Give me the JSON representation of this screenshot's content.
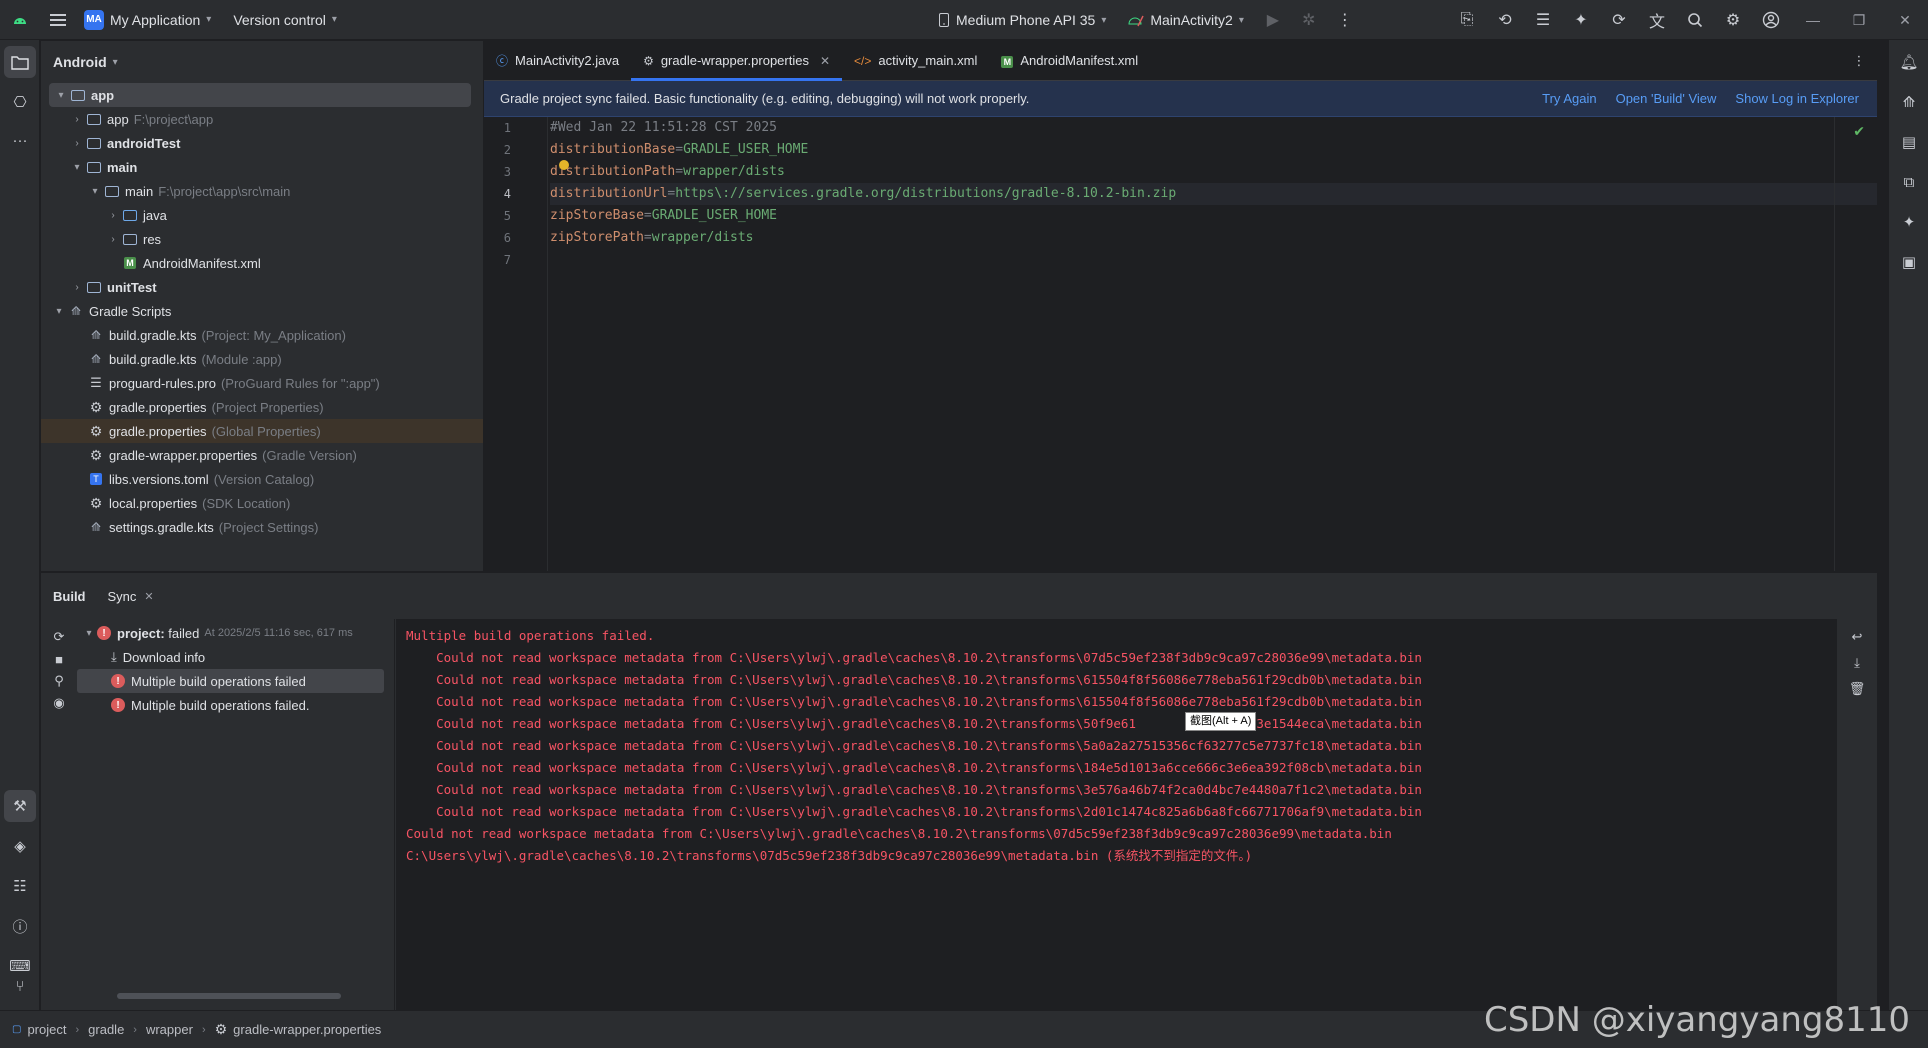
{
  "titlebar": {
    "project_badge": "MA",
    "project_name": "My Application",
    "version_control": "Version control",
    "device": "Medium Phone API 35",
    "run_config": "MainActivity2"
  },
  "project_panel": {
    "view_mode": "Android",
    "tree": [
      {
        "label": "app",
        "hint": "",
        "indent": 0
      },
      {
        "label": "app",
        "hint": "F:\\project\\app",
        "indent": 1
      },
      {
        "label": "androidTest",
        "hint": "",
        "indent": 1
      },
      {
        "label": "main",
        "hint": "",
        "indent": 1
      },
      {
        "label": "main",
        "hint": "F:\\project\\app\\src\\main",
        "indent": 2
      },
      {
        "label": "java",
        "hint": "",
        "indent": 3
      },
      {
        "label": "res",
        "hint": "",
        "indent": 3
      },
      {
        "label": "AndroidManifest.xml",
        "hint": "",
        "indent": 3
      },
      {
        "label": "unitTest",
        "hint": "",
        "indent": 1
      },
      {
        "label": "Gradle Scripts",
        "hint": "",
        "indent": 0
      },
      {
        "label": "build.gradle.kts",
        "hint": "(Project: My_Application)",
        "indent": 1
      },
      {
        "label": "build.gradle.kts",
        "hint": "(Module :app)",
        "indent": 1
      },
      {
        "label": "proguard-rules.pro",
        "hint": "(ProGuard Rules for \":app\")",
        "indent": 1
      },
      {
        "label": "gradle.properties",
        "hint": "(Project Properties)",
        "indent": 1
      },
      {
        "label": "gradle.properties",
        "hint": "(Global Properties)",
        "indent": 1
      },
      {
        "label": "gradle-wrapper.properties",
        "hint": "(Gradle Version)",
        "indent": 1
      },
      {
        "label": "libs.versions.toml",
        "hint": "(Version Catalog)",
        "indent": 1
      },
      {
        "label": "local.properties",
        "hint": "(SDK Location)",
        "indent": 1
      },
      {
        "label": "settings.gradle.kts",
        "hint": "(Project Settings)",
        "indent": 1
      }
    ]
  },
  "editor": {
    "tabs": [
      {
        "label": "MainActivity2.java"
      },
      {
        "label": "gradle-wrapper.properties"
      },
      {
        "label": "activity_main.xml"
      },
      {
        "label": "AndroidManifest.xml"
      }
    ],
    "banner": {
      "message": "Gradle project sync failed. Basic functionality (e.g. editing, debugging) will not work properly.",
      "try_again": "Try Again",
      "open_build": "Open 'Build' View",
      "show_log": "Show Log in Explorer"
    },
    "line_numbers": [
      "1",
      "2",
      "3",
      "4",
      "5",
      "6",
      "7"
    ],
    "lines": [
      {
        "key": "#Wed Jan 22 11:51:28 CST 2025",
        "eq": "",
        "value": ""
      },
      {
        "key": "distributionBase",
        "eq": "=",
        "value": "GRADLE_USER_HOME"
      },
      {
        "key": "distributionPath",
        "eq": "=",
        "value": "wrapper/dists"
      },
      {
        "key": "distributionUrl",
        "eq": "=",
        "value": "https\\://services.gradle.org/distributions/gradle-8.10.2-bin.zip"
      },
      {
        "key": "zipStoreBase",
        "eq": "=",
        "value": "GRADLE_USER_HOME"
      },
      {
        "key": "zipStorePath",
        "eq": "=",
        "value": "wrapper/dists"
      },
      {
        "key": "",
        "eq": "",
        "value": ""
      }
    ]
  },
  "build": {
    "tabs": {
      "build": "Build",
      "sync": "Sync"
    },
    "tree": {
      "project_label": "project:",
      "project_status": "failed",
      "project_meta": "At 2025/2/5 11:16 sec, 617 ms",
      "download": "Download info",
      "err1": "Multiple build operations failed",
      "err2": "Multiple build operations failed."
    },
    "output": [
      "Multiple build operations failed.",
      "    Could not read workspace metadata from C:\\Users\\ylwj\\.gradle\\caches\\8.10.2\\transforms\\07d5c59ef238f3db9c9ca97c28036e99\\metadata.bin",
      "    Could not read workspace metadata from C:\\Users\\ylwj\\.gradle\\caches\\8.10.2\\transforms\\615504f8f56086e778eba561f29cdb0b\\metadata.bin",
      "    Could not read workspace metadata from C:\\Users\\ylwj\\.gradle\\caches\\8.10.2\\transforms\\615504f8f56086e778eba561f29cdb0b\\metadata.bin",
      "    Could not read workspace metadata from C:\\Users\\ylwj\\.gradle\\caches\\8.10.2\\transforms\\50f9e61          d702453e1544eca\\metadata.bin",
      "    Could not read workspace metadata from C:\\Users\\ylwj\\.gradle\\caches\\8.10.2\\transforms\\5a0a2a27515356cf63277c5e7737fc18\\metadata.bin",
      "    Could not read workspace metadata from C:\\Users\\ylwj\\.gradle\\caches\\8.10.2\\transforms\\184e5d1013a6cce666c3e6ea392f08cb\\metadata.bin",
      "    Could not read workspace metadata from C:\\Users\\ylwj\\.gradle\\caches\\8.10.2\\transforms\\3e576a46b74f2ca0d4bc7e4480a7f1c2\\metadata.bin",
      "    Could not read workspace metadata from C:\\Users\\ylwj\\.gradle\\caches\\8.10.2\\transforms\\2d01c1474c825a6b6a8fc66771706af9\\metadata.bin",
      "Could not read workspace metadata from C:\\Users\\ylwj\\.gradle\\caches\\8.10.2\\transforms\\07d5c59ef238f3db9c9ca97c28036e99\\metadata.bin",
      "C:\\Users\\ylwj\\.gradle\\caches\\8.10.2\\transforms\\07d5c59ef238f3db9c9ca97c28036e99\\metadata.bin (系统找不到指定的文件。)"
    ],
    "tooltip": "截图(Alt + A)"
  },
  "statusbar": {
    "crumbs": [
      "project",
      "gradle",
      "wrapper",
      "gradle-wrapper.properties"
    ]
  },
  "watermark": "CSDN @xiyangyang8110"
}
